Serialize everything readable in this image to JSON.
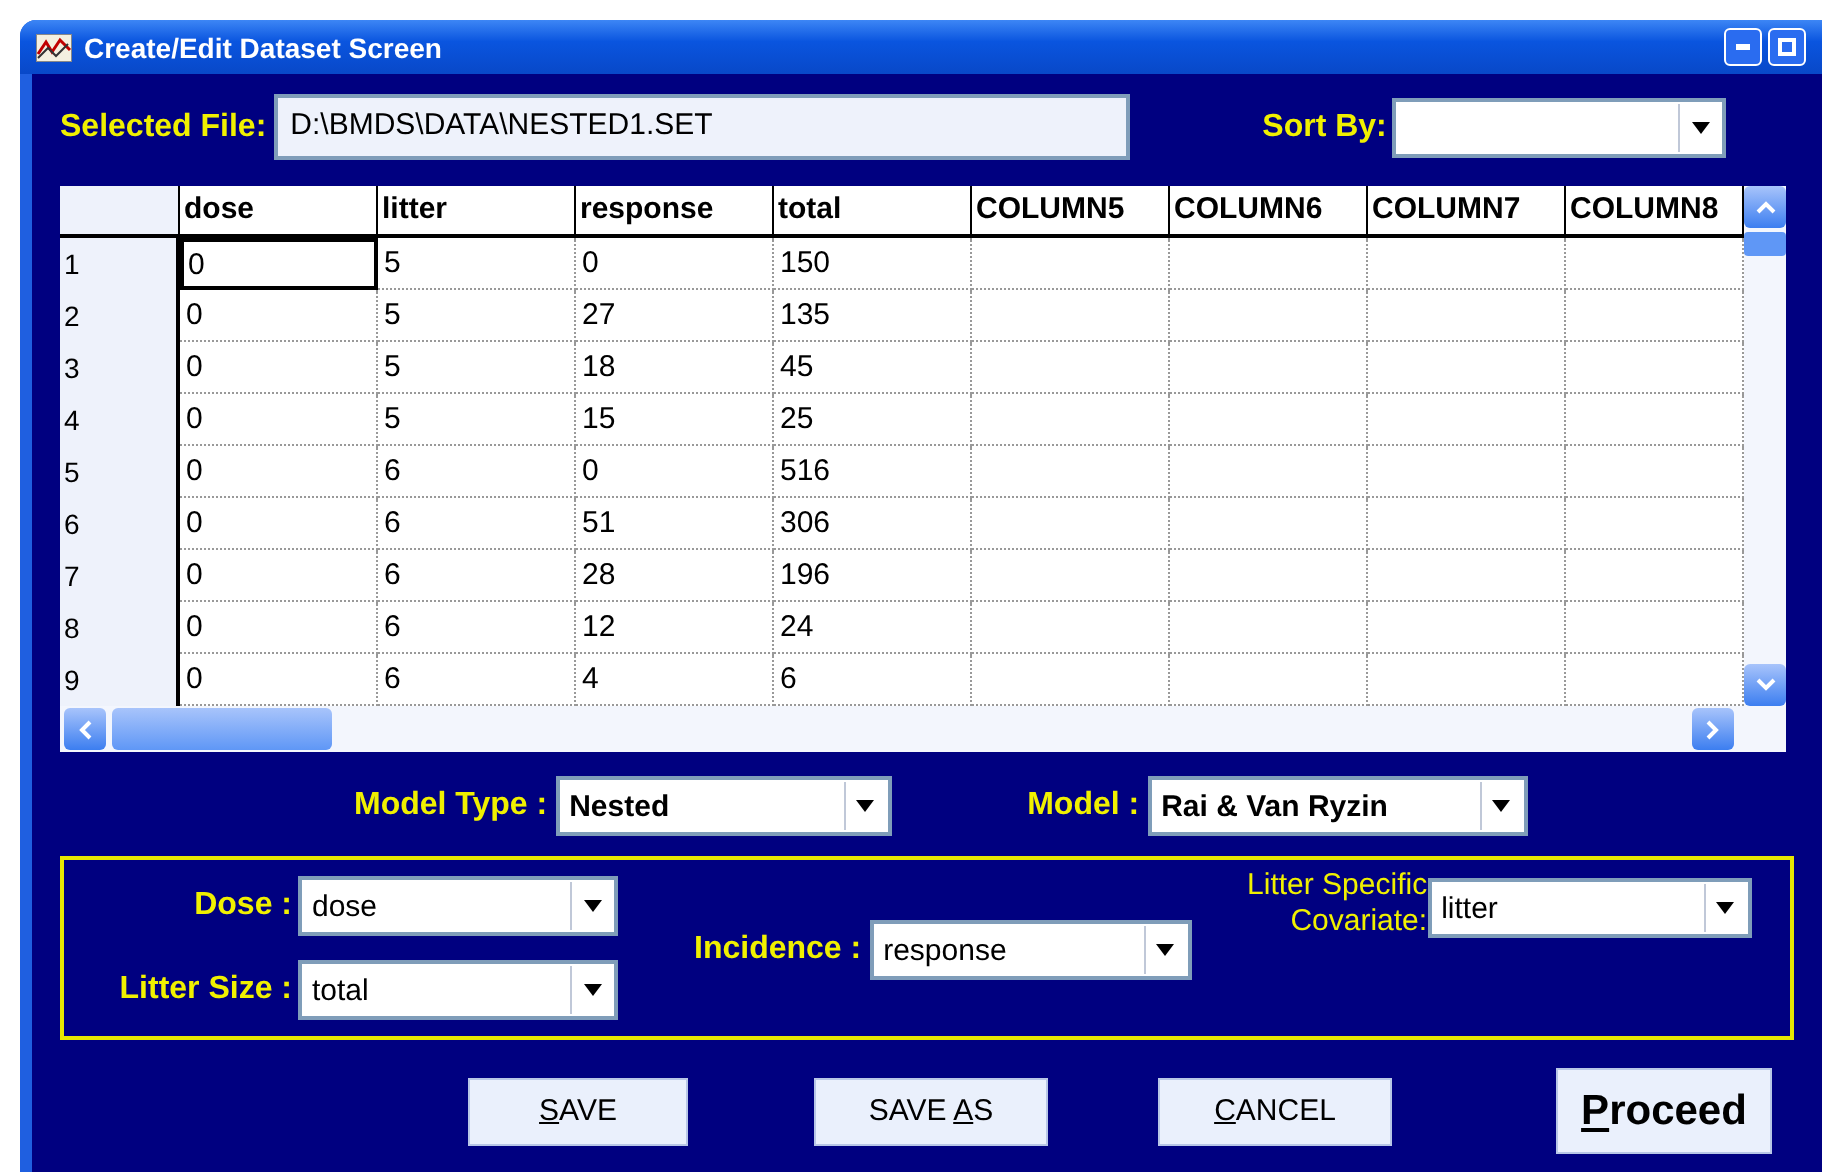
{
  "window": {
    "title": "Create/Edit Dataset Screen"
  },
  "selected_file": {
    "label": "Selected File:",
    "value": "D:\\BMDS\\DATA\\NESTED1.SET"
  },
  "sort_by": {
    "label": "Sort By:"
  },
  "grid": {
    "columns": [
      "dose",
      "litter",
      "response",
      "total",
      "COLUMN5",
      "COLUMN6",
      "COLUMN7",
      "COLUMN8"
    ],
    "rows": [
      {
        "number": "1",
        "cells": [
          {
            "text": "0",
            "focused": true
          },
          {
            "text": "5",
            "focused": false
          },
          {
            "text": "0",
            "focused": false
          },
          {
            "text": "150",
            "focused": false
          }
        ]
      },
      {
        "number": "2",
        "cells": [
          {
            "text": "0",
            "focused": false
          },
          {
            "text": "5",
            "focused": false
          },
          {
            "text": "27",
            "focused": false
          },
          {
            "text": "135",
            "focused": false
          }
        ]
      },
      {
        "number": "3",
        "cells": [
          {
            "text": "0",
            "focused": false
          },
          {
            "text": "5",
            "focused": false
          },
          {
            "text": "18",
            "focused": false
          },
          {
            "text": "45",
            "focused": false
          }
        ]
      },
      {
        "number": "4",
        "cells": [
          {
            "text": "0",
            "focused": false
          },
          {
            "text": "5",
            "focused": false
          },
          {
            "text": "15",
            "focused": false
          },
          {
            "text": "25",
            "focused": false
          }
        ]
      },
      {
        "number": "5",
        "cells": [
          {
            "text": "0",
            "focused": false
          },
          {
            "text": "6",
            "focused": false
          },
          {
            "text": "0",
            "focused": false
          },
          {
            "text": "516",
            "focused": false
          }
        ]
      },
      {
        "number": "6",
        "cells": [
          {
            "text": "0",
            "focused": false
          },
          {
            "text": "6",
            "focused": false
          },
          {
            "text": "51",
            "focused": false
          },
          {
            "text": "306",
            "focused": false
          }
        ]
      },
      {
        "number": "7",
        "cells": [
          {
            "text": "0",
            "focused": false
          },
          {
            "text": "6",
            "focused": false
          },
          {
            "text": "28",
            "focused": false
          },
          {
            "text": "196",
            "focused": false
          }
        ]
      },
      {
        "number": "8",
        "cells": [
          {
            "text": "0",
            "focused": false
          },
          {
            "text": "6",
            "focused": false
          },
          {
            "text": "12",
            "focused": false
          },
          {
            "text": "24",
            "focused": false
          }
        ]
      },
      {
        "number": "9",
        "cells": [
          {
            "text": "0",
            "focused": false
          },
          {
            "text": "6",
            "focused": false
          },
          {
            "text": "4",
            "focused": false
          },
          {
            "text": "6",
            "focused": false
          }
        ]
      }
    ]
  },
  "model_type": {
    "label": "Model  Type :",
    "value": "Nested"
  },
  "model": {
    "label": "Model :",
    "value": "Rai & Van Ryzin"
  },
  "variables": {
    "dose": {
      "label": "Dose :",
      "value": "dose"
    },
    "litter_size": {
      "label": "Litter Size :",
      "value": "total"
    },
    "incidence": {
      "label": "Incidence :",
      "value": "response"
    },
    "litter_specific_covariate": {
      "label": "Litter Specific Covariate:",
      "value": "litter"
    }
  },
  "buttons": [
    {
      "kind": "normal",
      "mnemonic": "S",
      "after": "AVE"
    },
    {
      "kind": "normal",
      "before": "SAVE ",
      "mnemonic": "A",
      "after": "S"
    },
    {
      "kind": "normal",
      "mnemonic": "C",
      "after": "ANCEL"
    },
    {
      "kind": "default",
      "mnemonic": "P",
      "after": "roceed"
    }
  ]
}
